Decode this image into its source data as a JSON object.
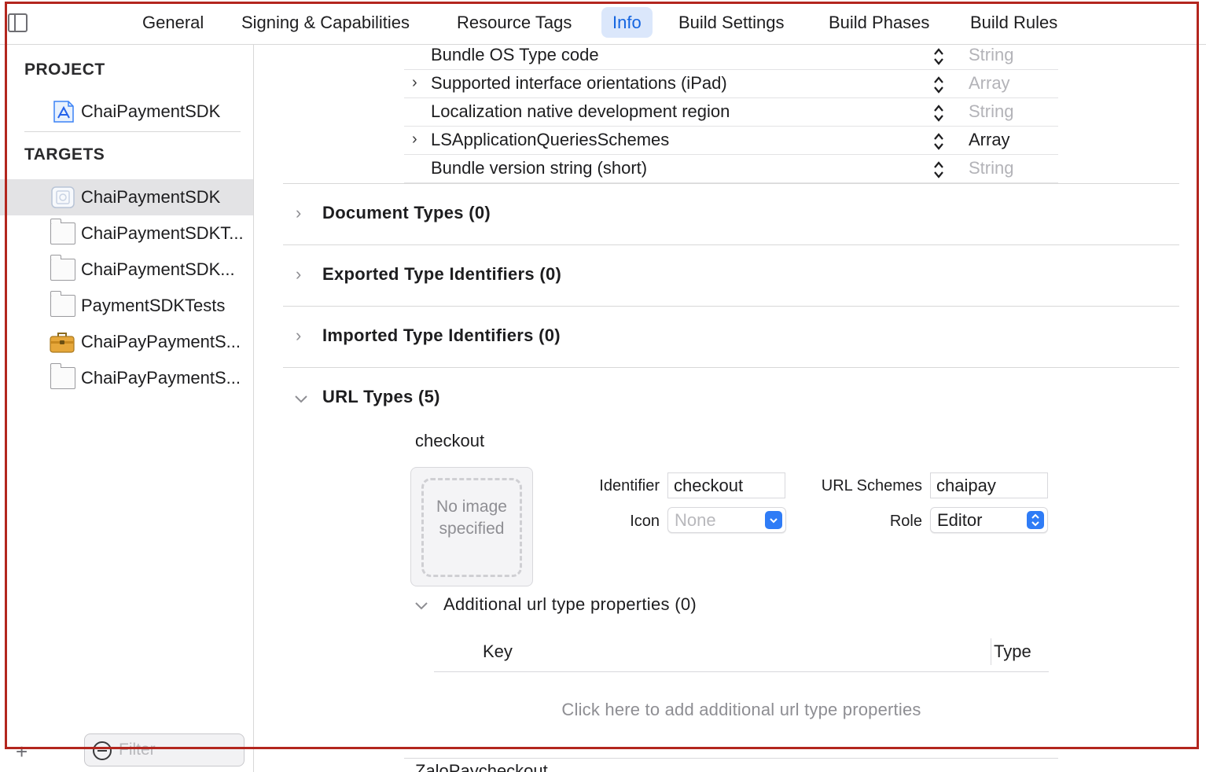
{
  "tabs": [
    {
      "label": "General"
    },
    {
      "label": "Signing & Capabilities"
    },
    {
      "label": "Resource Tags"
    },
    {
      "label": "Info",
      "active": true
    },
    {
      "label": "Build Settings"
    },
    {
      "label": "Build Phases"
    },
    {
      "label": "Build Rules"
    }
  ],
  "sidebar": {
    "project_header": "PROJECT",
    "project_item": {
      "label": "ChaiPaymentSDK",
      "icon": "xcode-project-icon"
    },
    "targets_header": "TARGETS",
    "targets": [
      {
        "label": "ChaiPaymentSDK",
        "icon": "framework-icon",
        "selected": true
      },
      {
        "label": "ChaiPaymentSDKT...",
        "icon": "folder-icon"
      },
      {
        "label": "ChaiPaymentSDK...",
        "icon": "folder-icon"
      },
      {
        "label": "PaymentSDKTests",
        "icon": "folder-icon"
      },
      {
        "label": "ChaiPayPaymentS...",
        "icon": "toolbox-icon"
      },
      {
        "label": "ChaiPayPaymentS...",
        "icon": "folder-icon"
      }
    ],
    "filter_placeholder": "Filter",
    "add_label": "+"
  },
  "plist_rows": [
    {
      "key": "Bundle OS Type code",
      "type": "String",
      "expandable": false,
      "dim": true
    },
    {
      "key": "Supported interface orientations (iPad)",
      "type": "Array",
      "expandable": true,
      "dim": true
    },
    {
      "key": "Localization native development region",
      "type": "String",
      "expandable": false,
      "dim": true
    },
    {
      "key": "LSApplicationQueriesSchemes",
      "type": "Array",
      "expandable": true,
      "dim": false
    },
    {
      "key": "Bundle version string (short)",
      "type": "String",
      "expandable": false,
      "dim": true
    }
  ],
  "sections": [
    {
      "title": "Document Types (0)",
      "expanded": false
    },
    {
      "title": "Exported Type Identifiers (0)",
      "expanded": false
    },
    {
      "title": "Imported Type Identifiers (0)",
      "expanded": false
    },
    {
      "title": "URL Types (5)",
      "expanded": true
    }
  ],
  "url_type": {
    "name": "checkout",
    "image_placeholder": "No image specified",
    "identifier_label": "Identifier",
    "identifier_value": "checkout",
    "icon_label": "Icon",
    "icon_value": "None",
    "schemes_label": "URL Schemes",
    "schemes_value": "chaipay",
    "role_label": "Role",
    "role_value": "Editor",
    "additional_title": "Additional url type properties (0)",
    "col_key": "Key",
    "col_type": "Type",
    "empty_hint": "Click here to add additional url type properties"
  },
  "next_url_type": {
    "name": "ZaloPaycheckout"
  },
  "colors": {
    "accent": "#1565e0",
    "tab_active_bg": "#dbe7fb",
    "highlight": "#b3261e"
  }
}
